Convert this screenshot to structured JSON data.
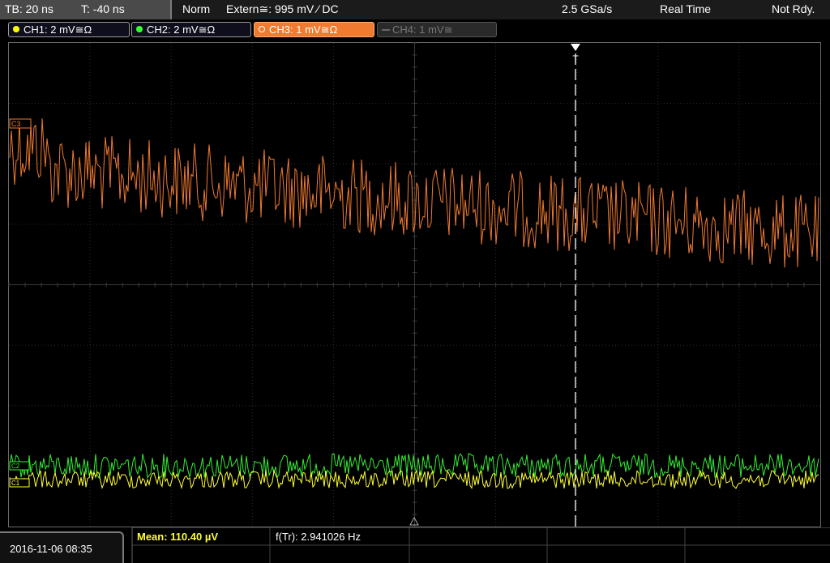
{
  "status": {
    "timebase": "TB: 20 ns",
    "trigger_time": "T: -40 ns",
    "mode": "Norm",
    "trigger_source": "Extern≅: 995 mV ⁄ DC",
    "sample_rate": "2.5 GSa/s",
    "acq_mode": "Real Time",
    "state": "Not Rdy."
  },
  "channels": [
    {
      "label": "CH1: 2 mV≅Ω",
      "color": "#ffff00",
      "active": true
    },
    {
      "label": "CH2: 2 mV≅Ω",
      "color": "#33ff33",
      "active": true
    },
    {
      "label": "CH3: 1 mV≅Ω",
      "color": "#ff8c3a",
      "active": true,
      "selected": true
    },
    {
      "label": "CH4: 1 mV≅",
      "color": "#666666",
      "active": false
    }
  ],
  "markers": {
    "ch3": "C3",
    "ch2": "C2",
    "ch1": "C1",
    "trigger": "T"
  },
  "bottom": {
    "datetime": "2016-11-06 08:35",
    "mean": "Mean: 110.40 µV",
    "freq": "f(Tr): 2.941026 Hz"
  },
  "colors": {
    "grid": "#3a3a3a",
    "ch1": "#ffff30",
    "ch2": "#33ee33",
    "ch3": "#f07a30"
  }
}
